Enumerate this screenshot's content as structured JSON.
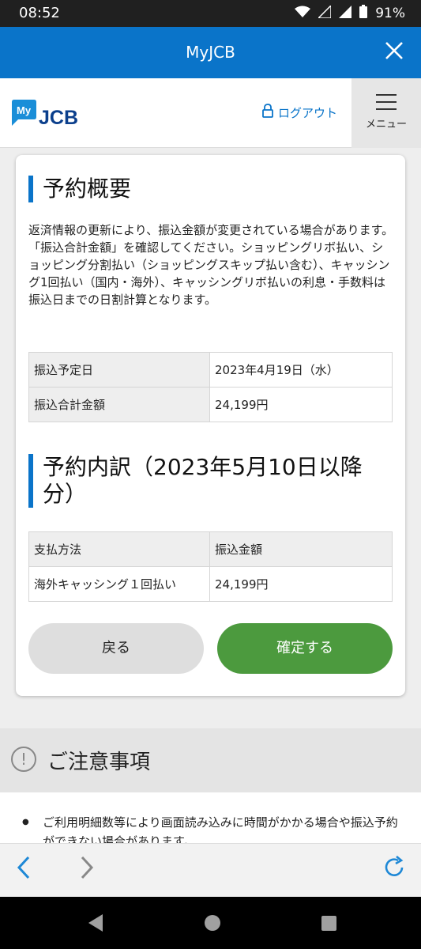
{
  "status_bar": {
    "time": "08:52",
    "battery": "91%"
  },
  "app_bar": {
    "title": "MyJCB"
  },
  "header": {
    "logo_my": "My",
    "logo_brand": "JCB",
    "logout_label": "ログアウト",
    "menu_label": "メニュー"
  },
  "summary": {
    "heading": "予約概要",
    "description": "返済情報の更新により、振込金額が変更されている場合があります。「振込合計金額」を確認してください。ショッピングリボ払い、ショッピング分割払い（ショッピングスキップ払い含む）、キャッシング1回払い（国内・海外）、キャッシングリボ払いの利息・手数料は振込日までの日割計算となります。",
    "rows": [
      {
        "label": "振込予定日",
        "value": "2023年4月19日（水）"
      },
      {
        "label": "振込合計金額",
        "value": "24,199円"
      }
    ]
  },
  "breakdown": {
    "heading": "予約内訳（2023年5月10日以降分）",
    "headers": [
      "支払方法",
      "振込金額"
    ],
    "rows": [
      {
        "method": "海外キャッシング１回払い",
        "amount": "24,199円"
      }
    ]
  },
  "buttons": {
    "back": "戻る",
    "confirm": "確定する"
  },
  "notice": {
    "title": "ご注意事項",
    "items": [
      "ご利用明細数等により画面読み込みに時間がかかる場合や振込予約ができない場合があります。"
    ]
  },
  "colors": {
    "primary_blue": "#0a74c9",
    "confirm_green": "#4c9a3e"
  },
  "icons": {
    "close": "close-icon",
    "lock": "lock-icon",
    "menu": "menu-icon",
    "notice": "exclamation-circle-icon",
    "browser_back": "chevron-left-icon",
    "browser_forward": "chevron-right-icon",
    "browser_reload": "reload-icon"
  }
}
